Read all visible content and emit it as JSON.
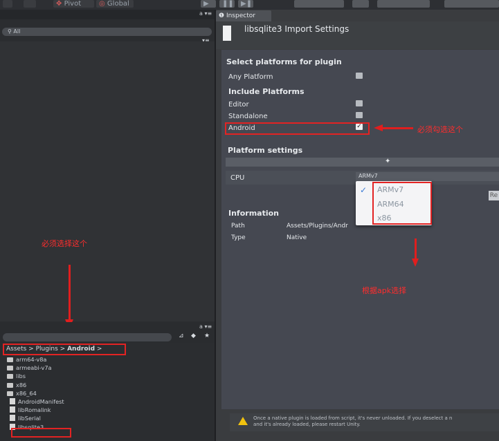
{
  "toolbar": {
    "pivot": "Pivot",
    "global": "Global"
  },
  "hierarchy": {
    "search_placeholder": "All"
  },
  "project": {
    "breadcrumb": [
      "Assets",
      "Plugins",
      "Android"
    ],
    "items": [
      {
        "name": "arm64-v8a",
        "kind": "folder"
      },
      {
        "name": "armeabi-v7a",
        "kind": "folder"
      },
      {
        "name": "libs",
        "kind": "folder"
      },
      {
        "name": "x86",
        "kind": "folder"
      },
      {
        "name": "x86_64",
        "kind": "folder"
      },
      {
        "name": "AndroidManifest",
        "kind": "file"
      },
      {
        "name": "libRomalink",
        "kind": "file"
      },
      {
        "name": "libSerial",
        "kind": "file"
      },
      {
        "name": "libsqlite3",
        "kind": "file"
      }
    ]
  },
  "inspector": {
    "tab": "Inspector",
    "title": "libsqlite3 Import Settings",
    "select_platforms": "Select platforms for plugin",
    "any_platform": "Any Platform",
    "include_platforms": "Include Platforms",
    "platforms": [
      {
        "label": "Editor",
        "checked": false
      },
      {
        "label": "Standalone",
        "checked": false
      },
      {
        "label": "Android",
        "checked": true
      }
    ],
    "platform_settings": "Platform settings",
    "cpu_label": "CPU",
    "cpu_value": "ARMv7",
    "cpu_options": [
      "ARMv7",
      "ARM64",
      "x86"
    ],
    "information": "Information",
    "path_label": "Path",
    "path_value": "Assets/Plugins/Andr",
    "type_label": "Type",
    "type_value": "Native",
    "reset_label": "Re",
    "warning_line1": "Once a native plugin is loaded from script, it's never unloaded. If you deselect a n",
    "warning_line2": "and it's already loaded, please restart Unity."
  },
  "annotations": {
    "must_check": "必须勾选这个",
    "must_select_this": "必须选择这个",
    "choose_by_apk": "根据apk选择"
  },
  "colors": {
    "annotation": "#e32323",
    "warning": "#f1c20f"
  }
}
